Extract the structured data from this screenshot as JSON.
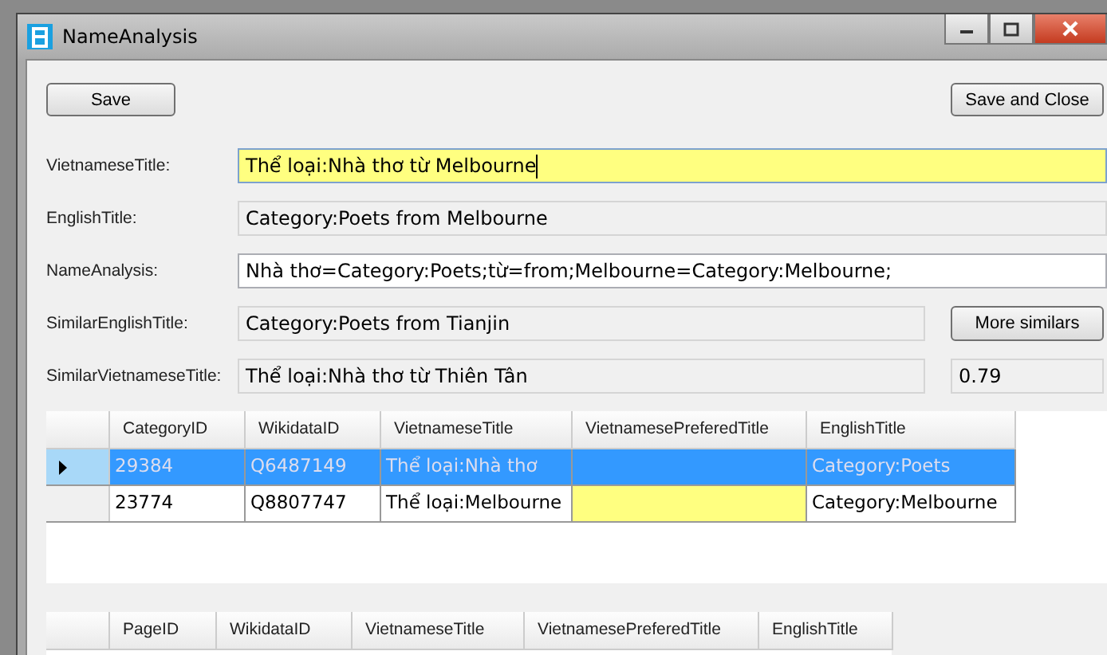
{
  "window": {
    "title": "NameAnalysis"
  },
  "buttons": [
    {
      "label": "Save"
    },
    {
      "label": "Save and Close"
    }
  ],
  "fields": [
    {
      "label": "VietnameseTitle:",
      "value": "Thể loại:Nhà thơ từ Melbourne",
      "readonly": false,
      "highlighted": true
    },
    {
      "label": "EnglishTitle:",
      "value": "Category:Poets from Melbourne",
      "readonly": true,
      "highlighted": false
    },
    {
      "label": "NameAnalysis:",
      "value": "Nhà thơ=Category:Poets;từ=from;Melbourne=Category:Melbourne;",
      "readonly": false,
      "highlighted": false
    },
    {
      "label": "SimilarEnglishTitle:",
      "value": "Category:Poets from Tianjin",
      "readonly": true,
      "highlighted": false,
      "side": {
        "kind": "button",
        "text": "More similars"
      }
    },
    {
      "label": "SimilarVietnameseTitle:",
      "value": "Thể loại:Nhà thơ từ Thiên Tân",
      "readonly": true,
      "highlighted": false,
      "side": {
        "kind": "field",
        "text": "0.79"
      }
    }
  ],
  "category_grid": {
    "columns": [
      "CategoryID",
      "WikidataID",
      "VietnameseTitle",
      "VietnamesePreferedTitle",
      "EnglishTitle"
    ],
    "rows": [
      {
        "selected": true,
        "cells": [
          "29384",
          "Q6487149",
          "Thể loại:Nhà thơ",
          "",
          "Category:Poets"
        ],
        "prefered_highlighted": false
      },
      {
        "selected": false,
        "cells": [
          "23774",
          "Q8807747",
          "Thể loại:Melbourne",
          "",
          "Category:Melbourne"
        ],
        "prefered_highlighted": true
      }
    ]
  },
  "page_grid": {
    "columns": [
      "PageID",
      "WikidataID",
      "VietnameseTitle",
      "VietnamesePreferedTitle",
      "EnglishTitle"
    ]
  }
}
